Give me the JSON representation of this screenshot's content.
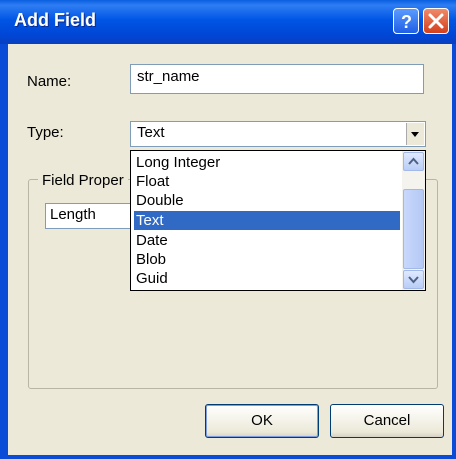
{
  "window": {
    "title": "Add Field"
  },
  "form": {
    "name_label": "Name:",
    "name_value": "str_name",
    "type_label": "Type:",
    "type_value": "Text"
  },
  "group": {
    "label": "Field Proper",
    "row_label": "Length"
  },
  "dropdown": {
    "options": [
      "Long Integer",
      "Float",
      "Double",
      "Text",
      "Date",
      "Blob",
      "Guid"
    ],
    "selected": "Text"
  },
  "buttons": {
    "ok": "OK",
    "cancel": "Cancel"
  },
  "icons": {
    "help": "help-icon",
    "close": "close-icon",
    "combo": "chevron-down-icon"
  }
}
